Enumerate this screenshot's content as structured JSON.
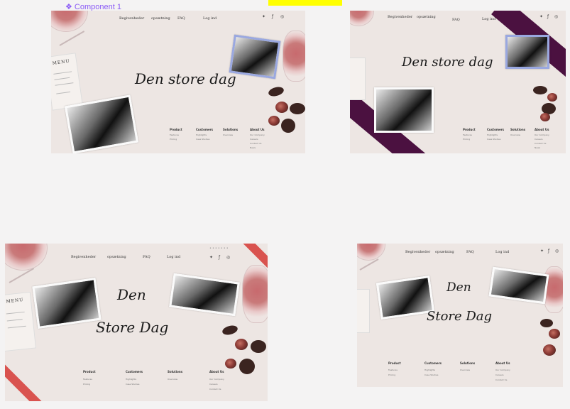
{
  "component_label": "❖ Component 1",
  "nav": [
    "Begivenheder",
    "opsætning",
    "FAQ",
    "Log ind"
  ],
  "title_single": "Den store dag",
  "title_line1": "Den",
  "title_line2": "Store Dag",
  "menu_title": "MENU",
  "footer": [
    {
      "heading": "Product",
      "items": [
        "Features",
        "Pricing"
      ]
    },
    {
      "heading": "Customers",
      "items": [
        "Highlights",
        "Case Studies"
      ]
    },
    {
      "heading": "Solutions",
      "items": [
        "Overview"
      ]
    },
    {
      "heading": "About Us",
      "items": [
        "Our Company",
        "Careers",
        "Contact Us",
        "News"
      ]
    }
  ],
  "social_icons": [
    "twitter-icon",
    "facebook-icon",
    "instagram-icon"
  ],
  "colors": {
    "background": "#ede6e3",
    "ribbon_purple": "#4b1140",
    "ribbon_red": "#d9534f",
    "accent_label": "#8b5cf6"
  }
}
